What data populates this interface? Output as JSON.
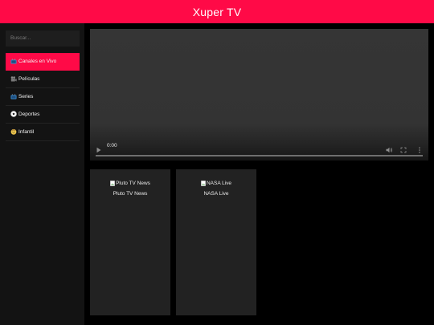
{
  "header": {
    "title": "Xuper TV",
    "accent_color": "#ff0a47"
  },
  "sidebar": {
    "search_placeholder": "Buscar...",
    "items": [
      {
        "label": "Canales en Vivo",
        "icon": "tv-icon",
        "active": true
      },
      {
        "label": "Películas",
        "icon": "movie-camera-icon",
        "active": false
      },
      {
        "label": "Series",
        "icon": "tv-icon",
        "active": false
      },
      {
        "label": "Deportes",
        "icon": "soccer-ball-icon",
        "active": false
      },
      {
        "label": "Infantil",
        "icon": "child-face-icon",
        "active": false
      }
    ]
  },
  "player": {
    "time": "0:00",
    "progress": 0
  },
  "channels": [
    {
      "alt": "Pluto TV News",
      "name": "Pluto TV News"
    },
    {
      "alt": "NASA Live",
      "name": "NASA Live"
    }
  ]
}
